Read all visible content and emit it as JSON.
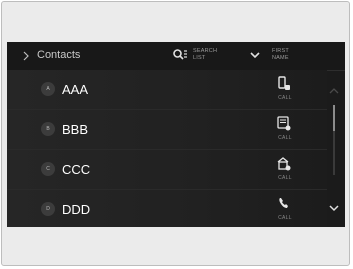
{
  "header": {
    "title": "Contacts",
    "search_label": "SEARCH\nLIST",
    "sort_label": "FIRST\nNAME"
  },
  "contacts": [
    {
      "letter": "A",
      "name": "AAA",
      "call_label": "CALL",
      "icon": "mobile-phone-icon"
    },
    {
      "letter": "B",
      "name": "BBB",
      "call_label": "CALL",
      "icon": "work-phone-icon"
    },
    {
      "letter": "C",
      "name": "CCC",
      "call_label": "CALL",
      "icon": "home-phone-icon"
    },
    {
      "letter": "D",
      "name": "DDD",
      "call_label": "CALL",
      "icon": "phone-handset-icon"
    }
  ],
  "colors": {
    "screen_bg": "#1b1b1b",
    "row_bg": "#242424",
    "text": "#ffffff",
    "muted": "#9a9a9a"
  }
}
